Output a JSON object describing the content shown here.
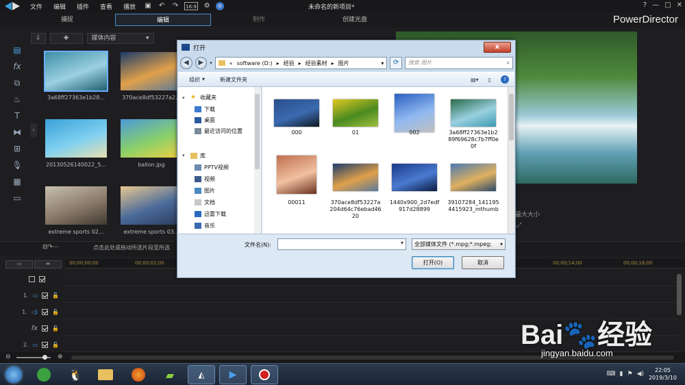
{
  "app": {
    "menus": [
      "文件",
      "编辑",
      "插件",
      "查看",
      "播放"
    ],
    "window_title": "未命名的新项目*",
    "brand": "PowerDirector",
    "mode_tabs": [
      {
        "label": "捕捉",
        "state": "normal"
      },
      {
        "label": "编辑",
        "state": "active"
      },
      {
        "label": "制作",
        "state": "dim"
      },
      {
        "label": "创建光盘",
        "state": "normal"
      }
    ],
    "toolbar_badge": "16:9",
    "library_dropdown": "媒体内容",
    "library_search": "搜索库",
    "library_items": [
      {
        "label": "3a68ff27363e1b28...",
        "colors": [
          "#3f8fa8",
          "#9bd0e0",
          "#1f6070"
        ]
      },
      {
        "label": "370ace8df53227a2...",
        "colors": [
          "#1d3d6a",
          "#e0a04a",
          "#5a7a9a"
        ]
      },
      {
        "label": "20130526140022_5...",
        "colors": [
          "#3aa0d8",
          "#7fd0f0",
          "#e8e0b0"
        ]
      },
      {
        "label": "ballon.jpg",
        "colors": [
          "#4a9ad8",
          "#8ad06a",
          "#f0d040"
        ]
      },
      {
        "label": "extreme sports 02...",
        "colors": [
          "#c8c0b0",
          "#8a7a6a",
          "#403830"
        ]
      },
      {
        "label": "extreme sports 03...",
        "colors": [
          "#e8c890",
          "#4a6a9a",
          "#2a3a5a"
        ]
      }
    ],
    "preview_label": "最大大小",
    "timeline_hint": "点击此处或拖动所选片段至所选",
    "ruler_ticks": [
      "00;00;00;00",
      "00;00;02;00",
      "00;00;14;00",
      "00;00;16;00"
    ],
    "tracks": [
      {
        "label": "",
        "type": "master"
      },
      {
        "label": "1.",
        "type": "video"
      },
      {
        "label": "1.",
        "type": "audio"
      },
      {
        "label": "fx",
        "type": "fx"
      },
      {
        "label": "2.",
        "type": "video"
      }
    ]
  },
  "dialog": {
    "title": "打开",
    "close": "x",
    "address": {
      "prefix": "«",
      "parts": [
        "software (D:)",
        "经验",
        "经验素材",
        "图片"
      ]
    },
    "search_placeholder": "搜索 图片",
    "organize": "组织",
    "new_folder": "新建文件夹",
    "nav": {
      "favorites_header": "收藏夹",
      "favorites": [
        "下载",
        "桌面",
        "最近访问的位置"
      ],
      "libraries_header": "库",
      "libraries": [
        "PPTV视频",
        "视频",
        "图片",
        "文档",
        "迅雷下载",
        "音乐"
      ]
    },
    "files": [
      {
        "name": "000",
        "colors": [
          "#2a4e8a",
          "#3a6ab0",
          "#101820"
        ]
      },
      {
        "name": "01",
        "colors": [
          "#e0c820",
          "#4a8a20",
          "#a0c040"
        ]
      },
      {
        "name": "002",
        "colors": [
          "#2a60c0",
          "#90b8f0",
          "#c0c0c0"
        ]
      },
      {
        "name": "3a68ff27363e1b289f69628c7b7ff0e0f",
        "colors": [
          "#2a6a4a",
          "#9ad0e0",
          "#3a9ab0"
        ]
      },
      {
        "name": "00011",
        "colors": [
          "#c07050",
          "#f0c0a0",
          "#6a3020"
        ]
      },
      {
        "name": "370ace8df53227a204d64c76ebad4620",
        "colors": [
          "#1d3d6a",
          "#e0a04a",
          "#5a7a9a"
        ]
      },
      {
        "name": "1440x900_2d7edf917d28899",
        "colors": [
          "#1a3a8a",
          "#4a7ad0",
          "#0a1a40"
        ]
      },
      {
        "name": "39107284_1411954415923_mthumb",
        "colors": [
          "#4a7ab0",
          "#e0b060",
          "#2a4a6a"
        ]
      }
    ],
    "filename_label": "文件名(N):",
    "filename_value": "",
    "filetype": "全部媒体文件 (*.mpg;*.mpeg;",
    "open_button": "打开(O)",
    "cancel_button": "取消"
  },
  "taskbar": {
    "time": "22:05",
    "date": "2019/3/10"
  },
  "watermark": {
    "logo": "Bai du 经验",
    "url": "jingyan.baidu.com"
  }
}
